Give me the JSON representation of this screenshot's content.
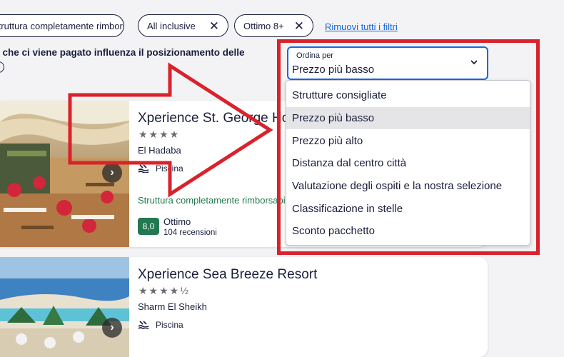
{
  "filters": {
    "chips": [
      {
        "label": "Struttura completamente rimborsabile",
        "remove": "✕"
      },
      {
        "label": "All inclusive",
        "remove": "✕"
      },
      {
        "label": "Ottimo 8+",
        "remove": "✕"
      }
    ],
    "remove_all": "Rimuovi tutti i filtri"
  },
  "disclaimer": "Ciò che ci viene pagato influenza il posizionamento delle",
  "sort": {
    "label": "Ordina per",
    "value": "Prezzo più basso",
    "options": [
      "Strutture consigliate",
      "Prezzo più basso",
      "Prezzo più alto",
      "Distanza dal centro città",
      "Valutazione degli ospiti e la nostra selezione",
      "Classificazione in stelle",
      "Sconto pacchetto"
    ],
    "selected_index": 1
  },
  "hotels": [
    {
      "name": "Xperience St. George Homestay",
      "stars_text": "★★★★",
      "stars": 4,
      "location": "El Hadaba",
      "amenity": "Piscina",
      "refund": "Struttura completamente rimborsabile",
      "score": "8,0",
      "score_label": "Ottimo",
      "reviews": "104 recensioni",
      "next": "›"
    },
    {
      "name": "Xperience Sea Breeze Resort",
      "stars_text": "★★★★½",
      "stars": 4.5,
      "location": "Sharm El Sheikh",
      "amenity": "Piscina",
      "next": "›"
    }
  ],
  "colors": {
    "accent": "#1668e3",
    "text": "#191e3b",
    "score_green": "#227950",
    "annotation_red": "#d9222c",
    "selected_option_bg": "#e5e5e8"
  },
  "icons": {
    "chip_remove": "close-icon",
    "dropdown": "chevron-down-icon",
    "amenity": "pool-icon",
    "carousel": "chevron-right-icon",
    "info": "info-icon"
  }
}
